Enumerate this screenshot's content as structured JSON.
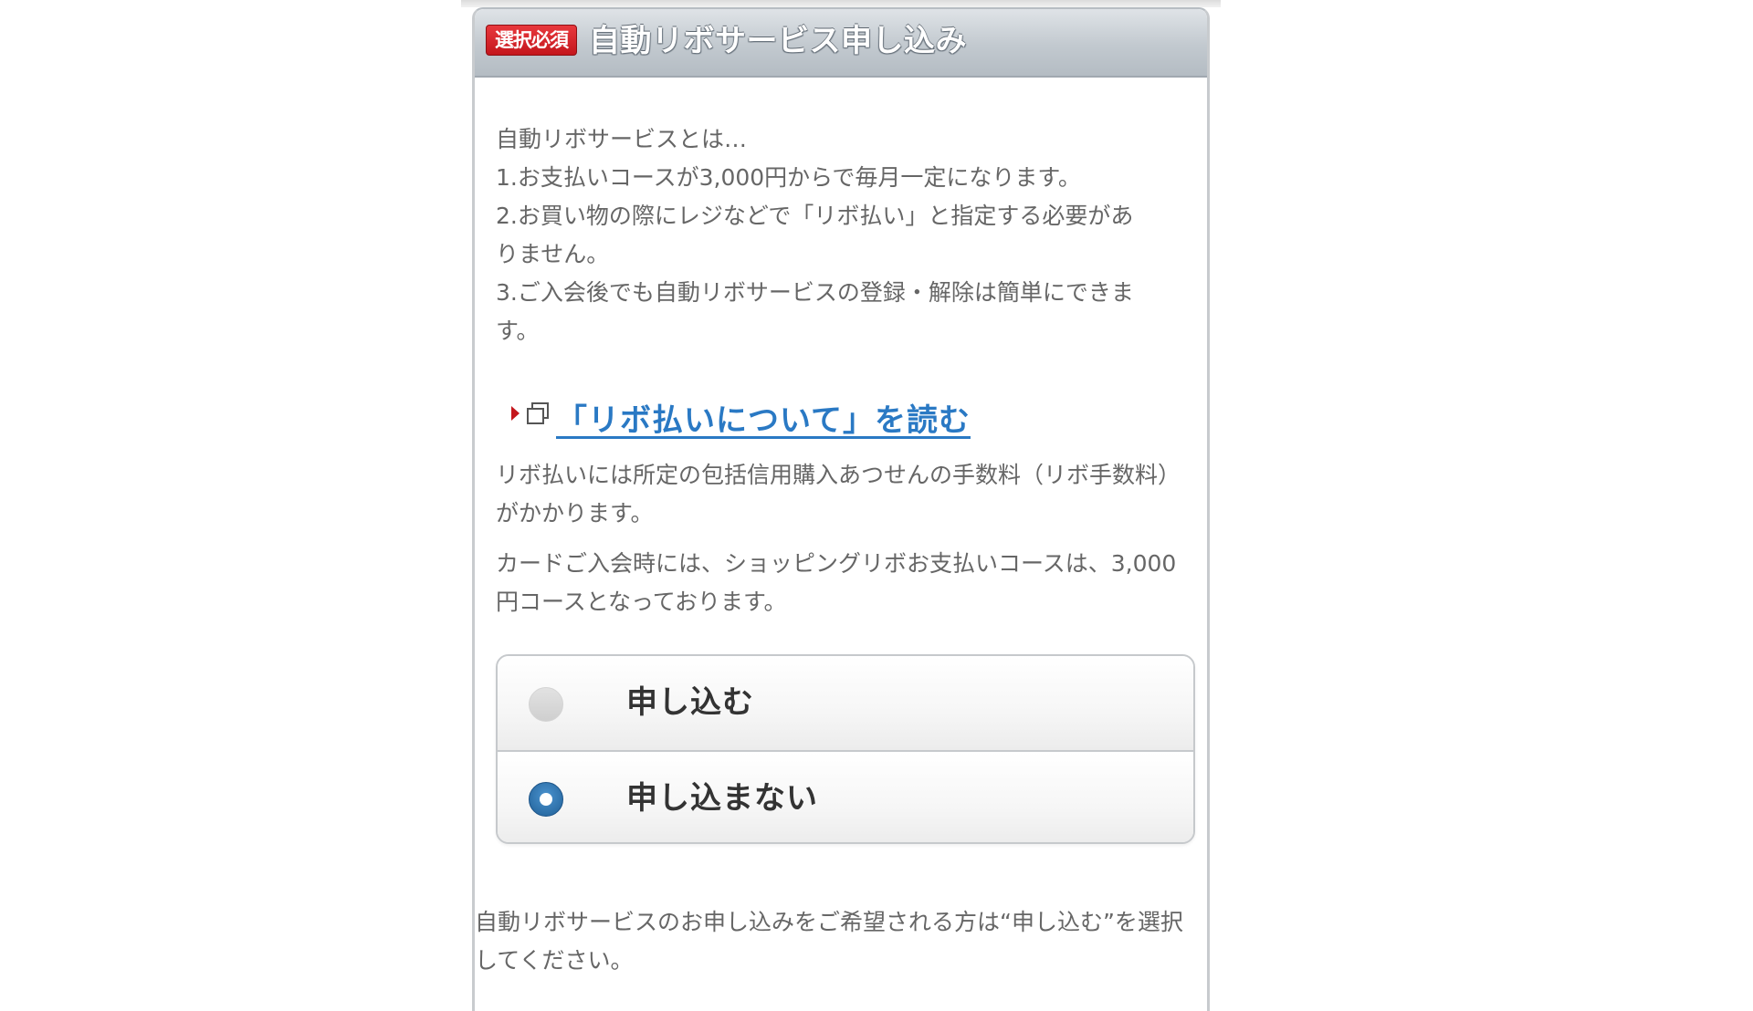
{
  "header": {
    "badge": "選択必須",
    "title": "自動リボサービス申し込み"
  },
  "description": {
    "lines": [
      "自動リボサービスとは…",
      "1.お支払いコースが3,000円からで毎月一定になります。",
      "2.お買い物の際にレジなどで「リボ払い」と指定する必要があ",
      "りません。",
      "3.ご入会後でも自動リボサービスの登録・解除は簡単にできま",
      "す。"
    ]
  },
  "link": {
    "label": "「リボ払いについて」を読む",
    "icons": [
      "arrow-right-icon",
      "external-window-icon"
    ],
    "color": "#2a79c4"
  },
  "notes": {
    "fee": "リボ払いには所定の包括信用購入あつせんの手数料（リボ手数料）がかかります。",
    "course": "カードご入会時には、ショッピングリボお支払いコースは、3,000円コースとなっております。"
  },
  "options": [
    {
      "label": "申し込む",
      "selected": false
    },
    {
      "label": "申し込まない",
      "selected": true
    }
  ],
  "footer": {
    "text": "自動リボサービスのお申し込みをご希望される方は“申し込む”を選択してください。"
  },
  "colors": {
    "badge_red": "#c4161c",
    "radio_selected": "#2f74b3",
    "body_text": "#666666"
  }
}
